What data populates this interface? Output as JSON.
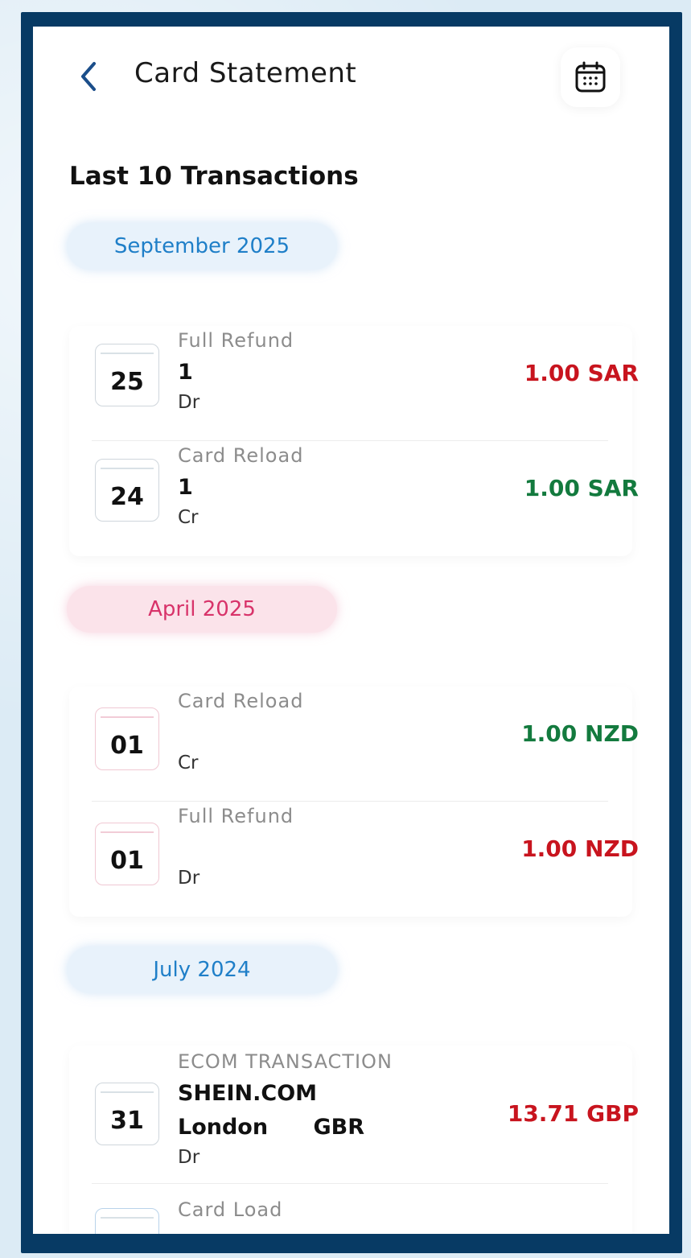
{
  "header": {
    "title": "Card Statement",
    "back_icon": "chevron-left-icon",
    "calendar_icon": "calendar-icon"
  },
  "section_title": "Last 10 Transactions",
  "colors": {
    "debit": "#c8141e",
    "credit": "#137a3e",
    "frame": "#073a64",
    "month_blue": "#1f7fc8",
    "month_pink": "#d8336a"
  },
  "groups": [
    {
      "month": "September 2025",
      "transactions": [
        {
          "day": "25",
          "type": "Full Refund",
          "desc": "1",
          "drcr": "Dr",
          "amount": "1.00 SAR",
          "direction": "debit"
        },
        {
          "day": "24",
          "type": "Card Reload",
          "desc": "1",
          "drcr": "Cr",
          "amount": "1.00 SAR",
          "direction": "credit"
        }
      ]
    },
    {
      "month": "April 2025",
      "transactions": [
        {
          "day": "01",
          "type": "Card Reload",
          "desc": "",
          "drcr": "Cr",
          "amount": "1.00 NZD",
          "direction": "credit"
        },
        {
          "day": "01",
          "type": "Full Refund",
          "desc": "",
          "drcr": "Dr",
          "amount": "1.00 NZD",
          "direction": "debit"
        }
      ]
    },
    {
      "month": "July 2024",
      "transactions": [
        {
          "day": "31",
          "type": "ECOM TRANSACTION",
          "desc": "SHEIN.COM",
          "desc2": "London      GBR",
          "drcr": "Dr",
          "amount": "13.71 GBP",
          "direction": "debit"
        },
        {
          "day": "",
          "type": "Card Load",
          "desc": "",
          "drcr": "",
          "amount": "",
          "direction": "credit"
        }
      ]
    }
  ]
}
